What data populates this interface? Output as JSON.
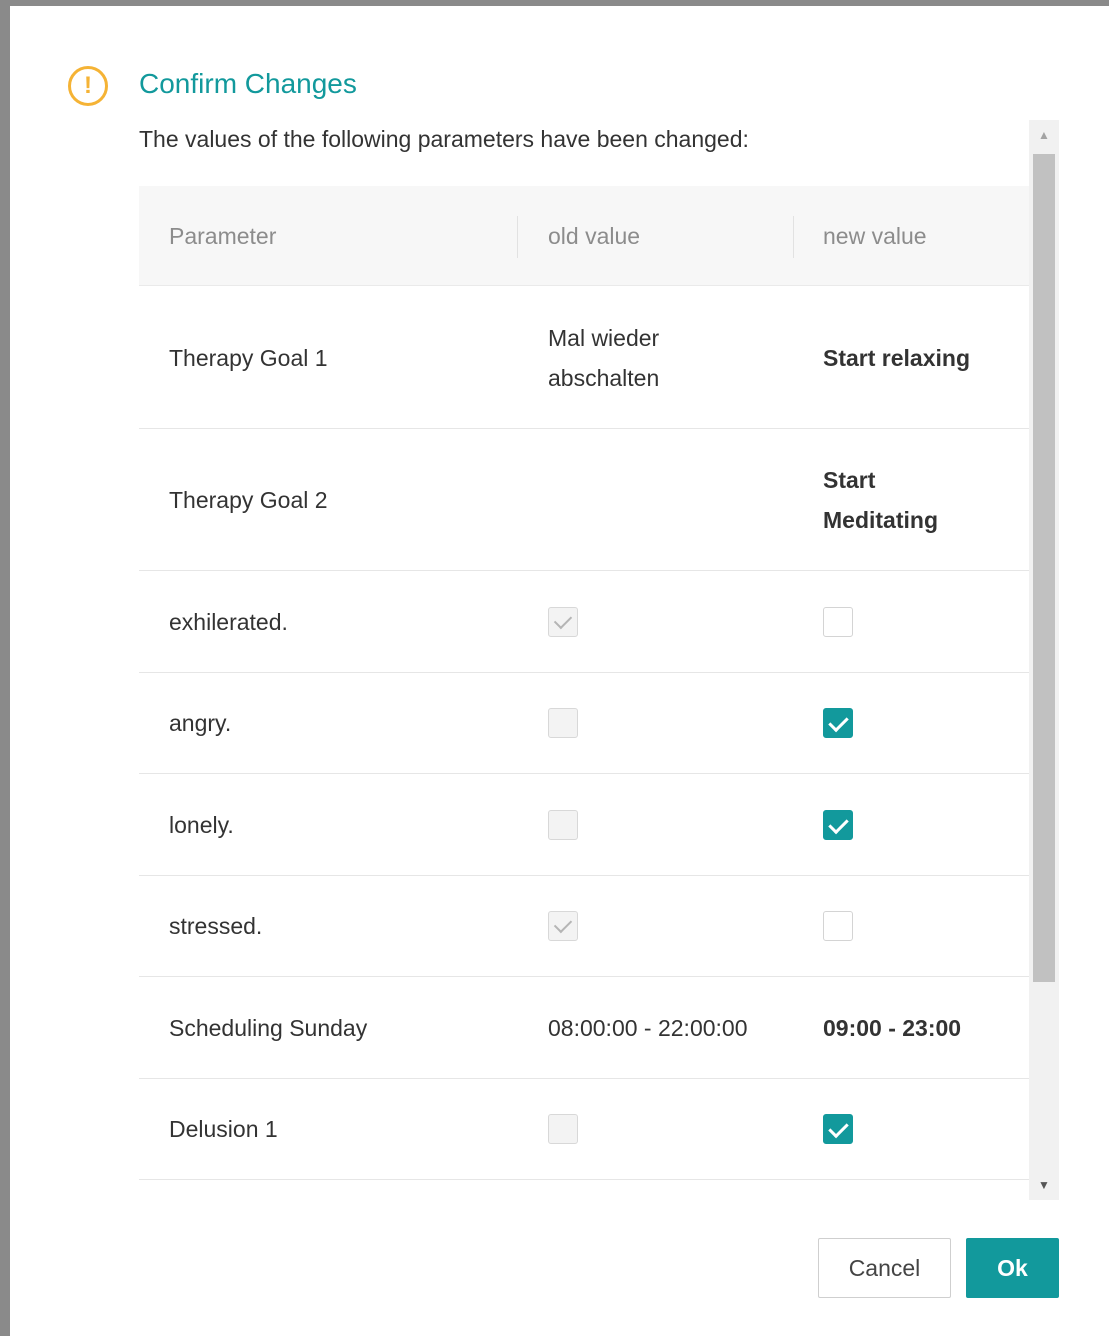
{
  "dialog": {
    "title": "Confirm Changes",
    "warning_glyph": "!",
    "subtitle": "The values of the following parameters have been changed:",
    "icon": "warning-icon",
    "accent_color": "#12999c",
    "warning_color": "#f5b335"
  },
  "table": {
    "headers": [
      "Parameter",
      "old value",
      "new value"
    ],
    "rows": [
      {
        "parameter": "Therapy Goal 1",
        "old": "Mal wieder abschalten",
        "new": "Start relaxing"
      },
      {
        "parameter": "Therapy Goal 2",
        "old": "",
        "new": "Start Meditating"
      },
      {
        "parameter": "exhilerated.",
        "old_checked": true,
        "new_checked": false
      },
      {
        "parameter": "angry.",
        "old_checked": false,
        "new_checked": true
      },
      {
        "parameter": "lonely.",
        "old_checked": false,
        "new_checked": true
      },
      {
        "parameter": "stressed.",
        "old_checked": true,
        "new_checked": false
      },
      {
        "parameter": "Scheduling Sunday",
        "old": "08:00:00 - 22:00:00",
        "new": "09:00 - 23:00"
      },
      {
        "parameter": "Delusion 1",
        "old_checked": false,
        "new_checked": true
      }
    ]
  },
  "buttons": {
    "cancel": "Cancel",
    "ok": "Ok"
  }
}
